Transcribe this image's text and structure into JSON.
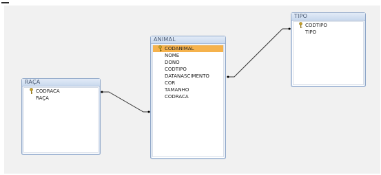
{
  "tables": [
    {
      "id": "TIPO",
      "title": "TIPO",
      "fields": [
        {
          "name": "CODTIPO",
          "key": true
        },
        {
          "name": "TIPO",
          "key": false
        }
      ]
    },
    {
      "id": "ANIMAL",
      "title": "ANIMAL",
      "fields": [
        {
          "name": "CODANIMAL",
          "key": true,
          "selected": true
        },
        {
          "name": "NOME",
          "key": false
        },
        {
          "name": "DONO",
          "key": false
        },
        {
          "name": "CODTIPO",
          "key": false
        },
        {
          "name": "DATANASCIMENTO",
          "key": false
        },
        {
          "name": "COR",
          "key": false
        },
        {
          "name": "TAMANHO",
          "key": false
        },
        {
          "name": "CODRACA",
          "key": false
        }
      ]
    },
    {
      "id": "RACA",
      "title": "RAÇA",
      "fields": [
        {
          "name": "CODRACA",
          "key": true
        },
        {
          "name": "RAÇA",
          "key": false
        }
      ]
    }
  ],
  "relationships": [
    {
      "from": "ANIMAL.CODTIPO",
      "to": "TIPO.CODTIPO"
    },
    {
      "from": "ANIMAL.CODRACA",
      "to": "RACA.CODRACA"
    }
  ],
  "colors": {
    "canvas": "#f1f1f1",
    "selected_field": "#f5b24c",
    "key_icon": "#c9a227"
  }
}
